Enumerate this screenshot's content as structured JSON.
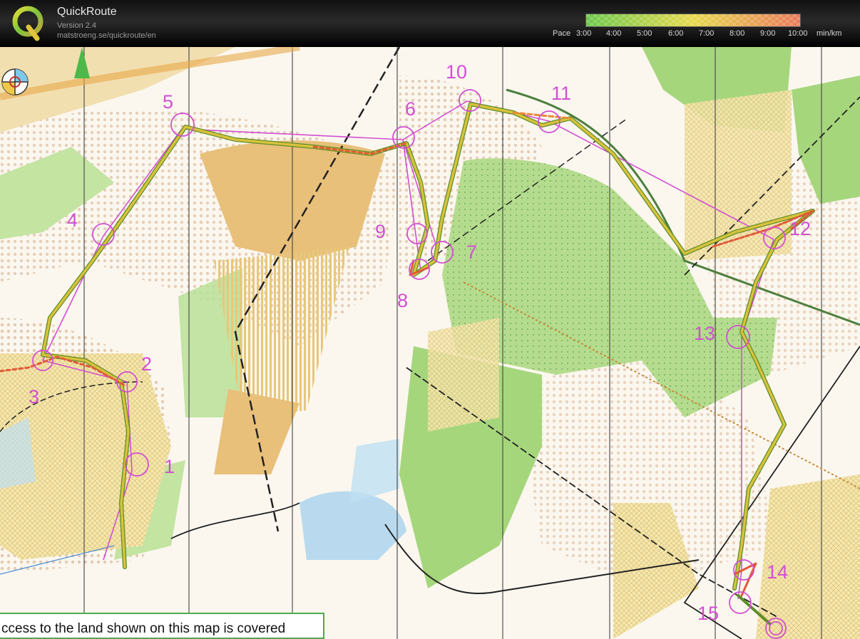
{
  "header": {
    "app_title": "QuickRoute",
    "version": "Version 2.4",
    "url": "matstroeng.se/quickroute/en"
  },
  "pace_scale": {
    "label": "Pace",
    "ticks": [
      "3:00",
      "4:00",
      "5:00",
      "6:00",
      "7:00",
      "8:00",
      "9:00",
      "10:00"
    ],
    "unit": "min/km",
    "colors": [
      "#6bc84a",
      "#e8d84c",
      "#e87a5a"
    ]
  },
  "map": {
    "course_color": "#d24fd2",
    "route_colors": [
      "#8fbf3c",
      "#d8c23c",
      "#e05a3a"
    ],
    "controls": [
      {
        "number": "1"
      },
      {
        "number": "2"
      },
      {
        "number": "3"
      },
      {
        "number": "4"
      },
      {
        "number": "5"
      },
      {
        "number": "6"
      },
      {
        "number": "7"
      },
      {
        "number": "8"
      },
      {
        "number": "9"
      },
      {
        "number": "10"
      },
      {
        "number": "11"
      },
      {
        "number": "12"
      },
      {
        "number": "13"
      },
      {
        "number": "14"
      },
      {
        "number": "15"
      }
    ],
    "notice_text": "ccess to the land shown on this map is covered"
  }
}
